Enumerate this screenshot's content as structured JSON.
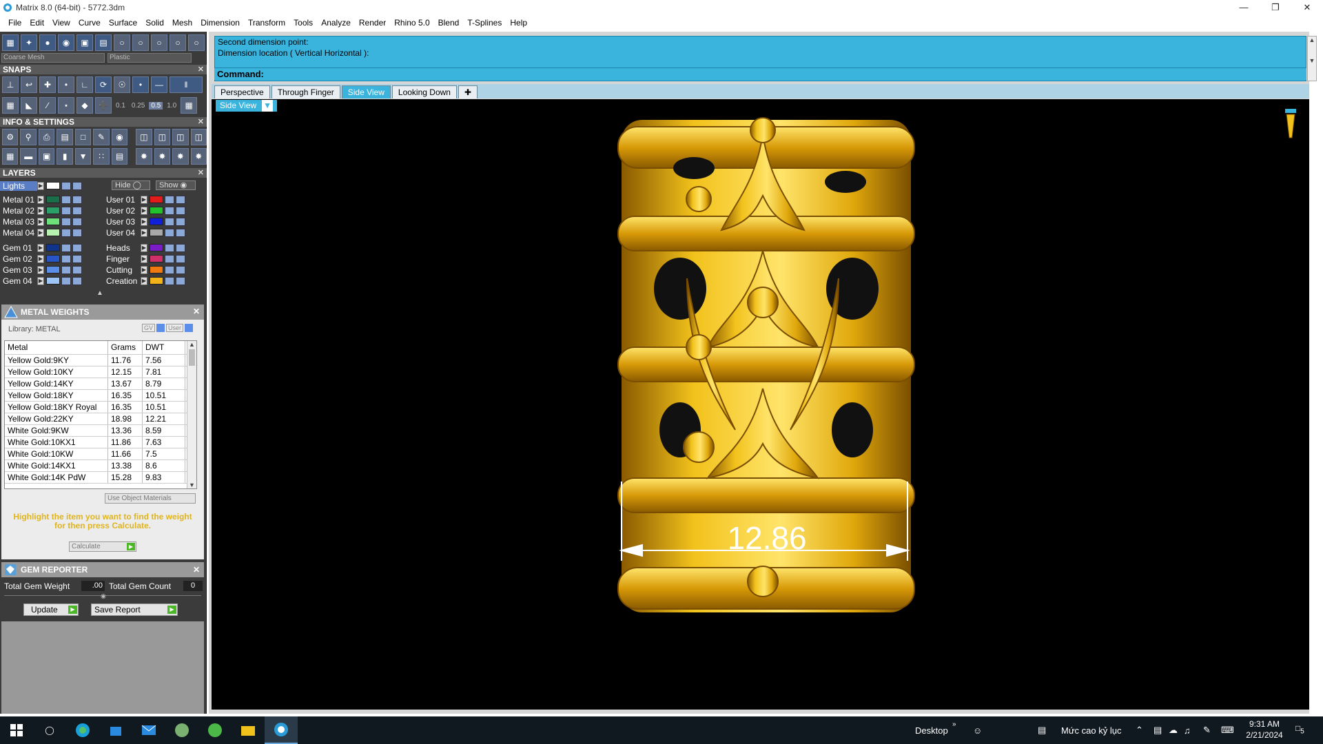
{
  "app": {
    "title": "Matrix 8.0 (64-bit) - 5772.3dm"
  },
  "menu": [
    "File",
    "Edit",
    "View",
    "Curve",
    "Surface",
    "Solid",
    "Mesh",
    "Dimension",
    "Transform",
    "Tools",
    "Analyze",
    "Render",
    "Rhino 5.0",
    "Blend",
    "T-Splines",
    "Help"
  ],
  "toolbar_top": {
    "mesh_select": "Coarse Mesh",
    "material_select": "Plastic"
  },
  "panels": {
    "snaps_title": "SNAPS",
    "info_title": "INFO & SETTINGS",
    "layers_title": "LAYERS",
    "metal_weights_title": "METAL WEIGHTS",
    "gem_reporter_title": "GEM REPORTER"
  },
  "snap_values": [
    "0.1",
    "0.25",
    "0.5",
    "1.0"
  ],
  "layers": {
    "lights_label": "Lights",
    "hide_label": "Hide",
    "show_label": "Show",
    "left": [
      {
        "name": "Metal 01",
        "color": "#1a6e49"
      },
      {
        "name": "Metal 02",
        "color": "#2aa068"
      },
      {
        "name": "Metal 03",
        "color": "#6ee07a"
      },
      {
        "name": "Metal 04",
        "color": "#b8f2b0"
      },
      {
        "name": "Gem 01",
        "color": "#10348c"
      },
      {
        "name": "Gem 02",
        "color": "#2855c8"
      },
      {
        "name": "Gem 03",
        "color": "#5a8ee8"
      },
      {
        "name": "Gem 04",
        "color": "#9cc4f4"
      }
    ],
    "right": [
      {
        "name": "User 01",
        "color": "#e21b1b"
      },
      {
        "name": "User 02",
        "color": "#21c22b"
      },
      {
        "name": "User 03",
        "color": "#1020d8"
      },
      {
        "name": "User 04",
        "color": "#a8a8a8"
      },
      {
        "name": "Heads",
        "color": "#7a1cc8"
      },
      {
        "name": "Finger",
        "color": "#d0306a"
      },
      {
        "name": "Cutting",
        "color": "#f07a10"
      },
      {
        "name": "Creation",
        "color": "#f2b21a"
      }
    ]
  },
  "metal_weights": {
    "library_label": "Library: METAL",
    "gv_label": "GV",
    "user_label": "User",
    "columns": [
      "Metal",
      "Grams",
      "DWT"
    ],
    "rows": [
      [
        "Yellow Gold:9KY",
        "11.76",
        "7.56"
      ],
      [
        "Yellow Gold:10KY",
        "12.15",
        "7.81"
      ],
      [
        "Yellow Gold:14KY",
        "13.67",
        "8.79"
      ],
      [
        "Yellow Gold:18KY",
        "16.35",
        "10.51"
      ],
      [
        "Yellow Gold:18KY Royal",
        "16.35",
        "10.51"
      ],
      [
        "Yellow Gold:22KY",
        "18.98",
        "12.21"
      ],
      [
        "White Gold:9KW",
        "13.36",
        "8.59"
      ],
      [
        "White Gold:10KX1",
        "11.86",
        "7.63"
      ],
      [
        "White Gold:10KW",
        "11.66",
        "7.5"
      ],
      [
        "White Gold:14KX1",
        "13.38",
        "8.6"
      ],
      [
        "White Gold:14K PdW",
        "15.28",
        "9.83"
      ]
    ],
    "use_object_materials": "Use Object Materials",
    "hint": "Highlight the item you want to find the weight for then press Calculate.",
    "calculate_label": "Calculate"
  },
  "gem_reporter": {
    "total_weight_label": "Total Gem Weight",
    "total_weight_value": ".00",
    "total_count_label": "Total Gem Count",
    "total_count_value": "0",
    "update_label": "Update",
    "save_report_label": "Save Report"
  },
  "command": {
    "line1": "Second dimension point:",
    "line2": "Dimension location ( Vertical  Horizontal ):",
    "prompt": "Command:"
  },
  "view_tabs": [
    "Perspective",
    "Through Finger",
    "Side View",
    "Looking Down"
  ],
  "active_view_tab": "Side View",
  "viewport": {
    "label": "Side View",
    "dimension_value": "12.86",
    "model_color": "#e0a80c"
  },
  "taskbar": {
    "desktop_label": "Desktop",
    "ime_label": "Mức cao kỷ lục",
    "time": "9:31 AM",
    "date": "2/21/2024",
    "notification_count": "5"
  }
}
